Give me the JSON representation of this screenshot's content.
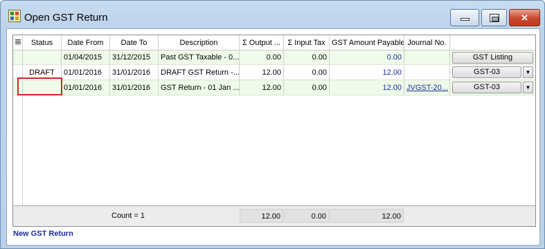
{
  "window": {
    "title": "Open GST Return",
    "controls": {
      "minimize": "minimize",
      "maximize": "maximize",
      "close": "×"
    }
  },
  "grid": {
    "columns": [
      "Status",
      "Date From",
      "Date To",
      "Description",
      "Σ Output ...",
      "Σ Input Tax",
      "GST Amount Payable",
      "Journal No.",
      ""
    ],
    "rows": [
      {
        "status": "",
        "date_from": "01/04/2015",
        "date_to": "31/12/2015",
        "description": "Past GST Taxable - 0...",
        "output": "0.00",
        "input": "0.00",
        "payable": "0.00",
        "journal": "",
        "action": "GST Listing"
      },
      {
        "status": "DRAFT",
        "date_from": "01/01/2016",
        "date_to": "31/01/2016",
        "description": "DRAFT GST Return -...",
        "output": "12.00",
        "input": "0.00",
        "payable": "12.00",
        "journal": "",
        "action": "GST-03"
      },
      {
        "status": "",
        "date_from": "01/01/2016",
        "date_to": "31/01/2016",
        "description": "GST Return - 01 Jan ...",
        "output": "12.00",
        "input": "0.00",
        "payable": "12.00",
        "journal": "JVGST-20...",
        "action": "GST-03"
      }
    ],
    "footer": {
      "count": "Count = 1",
      "output_total": "12.00",
      "input_total": "0.00",
      "payable_total": "12.00"
    }
  },
  "actions": {
    "new_return": "New GST Return"
  },
  "colors": {
    "highlight_border": "#d62121",
    "link": "#1b2a9e",
    "row_alt": "#eefbe9"
  }
}
